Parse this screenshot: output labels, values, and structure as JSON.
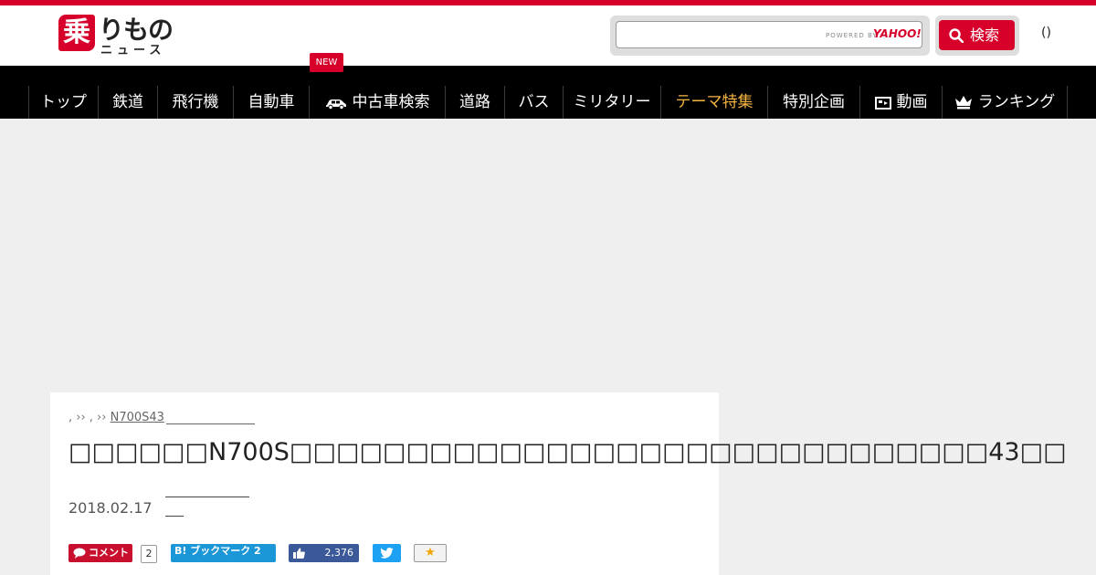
{
  "header": {
    "logo_kanji": "乗",
    "logo_kana": "りもの",
    "logo_news": "ニュース",
    "search_placeholder": "",
    "powered_by": "POWERED BY",
    "yahoo": "YAHOO!",
    "search_button": "検索",
    "paren_text": "()"
  },
  "nav": {
    "new_badge": "NEW",
    "items": [
      {
        "label": "トップ"
      },
      {
        "label": "鉄道"
      },
      {
        "label": "飛行機"
      },
      {
        "label": "自動車"
      },
      {
        "label": "中古車検索",
        "icon": "car-icon"
      },
      {
        "label": "道路"
      },
      {
        "label": "バス"
      },
      {
        "label": "ミリタリー"
      },
      {
        "label": "テーマ特集",
        "accent": "#f5b53f"
      },
      {
        "label": "特別企画"
      },
      {
        "label": "動画",
        "icon": "video-icon"
      },
      {
        "label": "ランキング",
        "icon": "crown-icon"
      }
    ]
  },
  "article": {
    "breadcrumb_prefix": ", ›› , ›› ",
    "breadcrumb_link": "N700S43",
    "title": "□□□□□□N700S□□□□□□□□□□□□□□□□□□□□□□□□□□□□□□43□□",
    "date": "2018.02.17",
    "share": {
      "comment_label": "コメント",
      "comment_count": "2",
      "hatena_label": "B! ブックマーク 2",
      "like_count": "2,376",
      "fav_star": "★"
    }
  },
  "colors": {
    "brand_red": "#d6002b",
    "nav_bg": "#000000",
    "accent": "#f5b53f"
  }
}
